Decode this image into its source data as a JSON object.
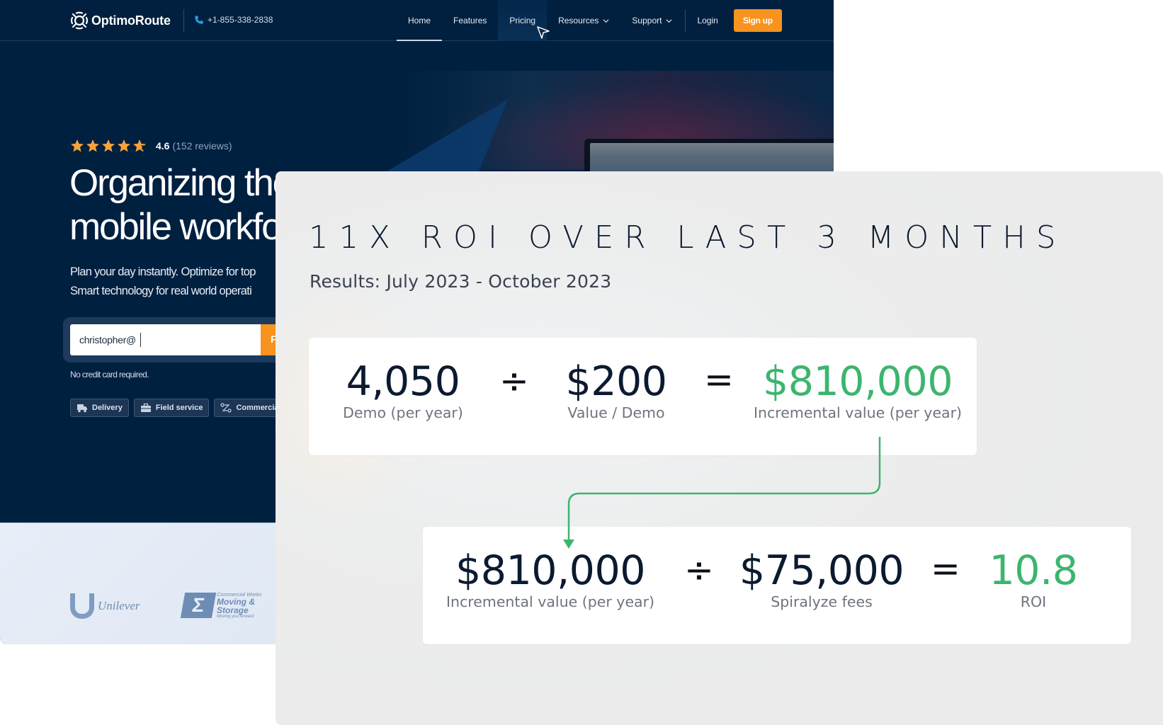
{
  "site": {
    "brand": "OptimoRoute",
    "phone": "+1-855-338-2838",
    "nav": {
      "items": [
        {
          "label": "Home",
          "active": true,
          "dropdown": false
        },
        {
          "label": "Features",
          "active": false,
          "dropdown": false
        },
        {
          "label": "Pricing",
          "active": false,
          "dropdown": false,
          "hovered": true
        },
        {
          "label": "Resources",
          "active": false,
          "dropdown": true
        },
        {
          "label": "Support",
          "active": false,
          "dropdown": true
        }
      ],
      "login": "Login",
      "signup": "Sign up"
    },
    "rating": {
      "stars": 4.6,
      "max_stars": 5,
      "score": "4.6",
      "reviews": "(152 reviews)"
    },
    "hero": {
      "headline_line1": "Organizing the",
      "headline_line2": "mobile workfo",
      "sub_line1": "Plan your day instantly. Optimize for top",
      "sub_line2": "Smart technology for real world operati"
    },
    "email": {
      "value": "christopher@",
      "submit_label": "F"
    },
    "no_credit_card": "No credit card required.",
    "chips": [
      {
        "label": "Delivery",
        "icon": "truck-icon"
      },
      {
        "label": "Field service",
        "icon": "briefcase-icon"
      },
      {
        "label": "Commercial",
        "icon": "route-icon"
      }
    ],
    "clients": {
      "unilever": "Unilever",
      "cw_top": "Commercial Works",
      "cw_line1": "Moving &",
      "cw_line2": "Storage",
      "cw_tagline": "Moving you forward"
    },
    "colors": {
      "navy": "#002040",
      "orange": "#f7931e",
      "star": "#f8a23a"
    }
  },
  "roi": {
    "title": "11X ROI OVER LAST 3 MONTHS",
    "subtitle": "Results: July 2023 - October 2023",
    "equation1": {
      "a_value": "4,050",
      "a_label": "Demo (per year)",
      "op1": "÷",
      "b_value": "$200",
      "b_label": "Value / Demo",
      "op2": "=",
      "result_value": "$810,000",
      "result_label": "Incremental value (per year)"
    },
    "equation2": {
      "a_value": "$810,000",
      "a_label": "Incremental value (per year)",
      "op1": "÷",
      "b_value": "$75,000",
      "b_label": "Spiralyze fees",
      "op2": "=",
      "result_value": "10.8",
      "result_label": "ROI"
    },
    "colors": {
      "text": "#0b1a30",
      "label": "#6e737d",
      "accent_green": "#3cb56e"
    }
  }
}
